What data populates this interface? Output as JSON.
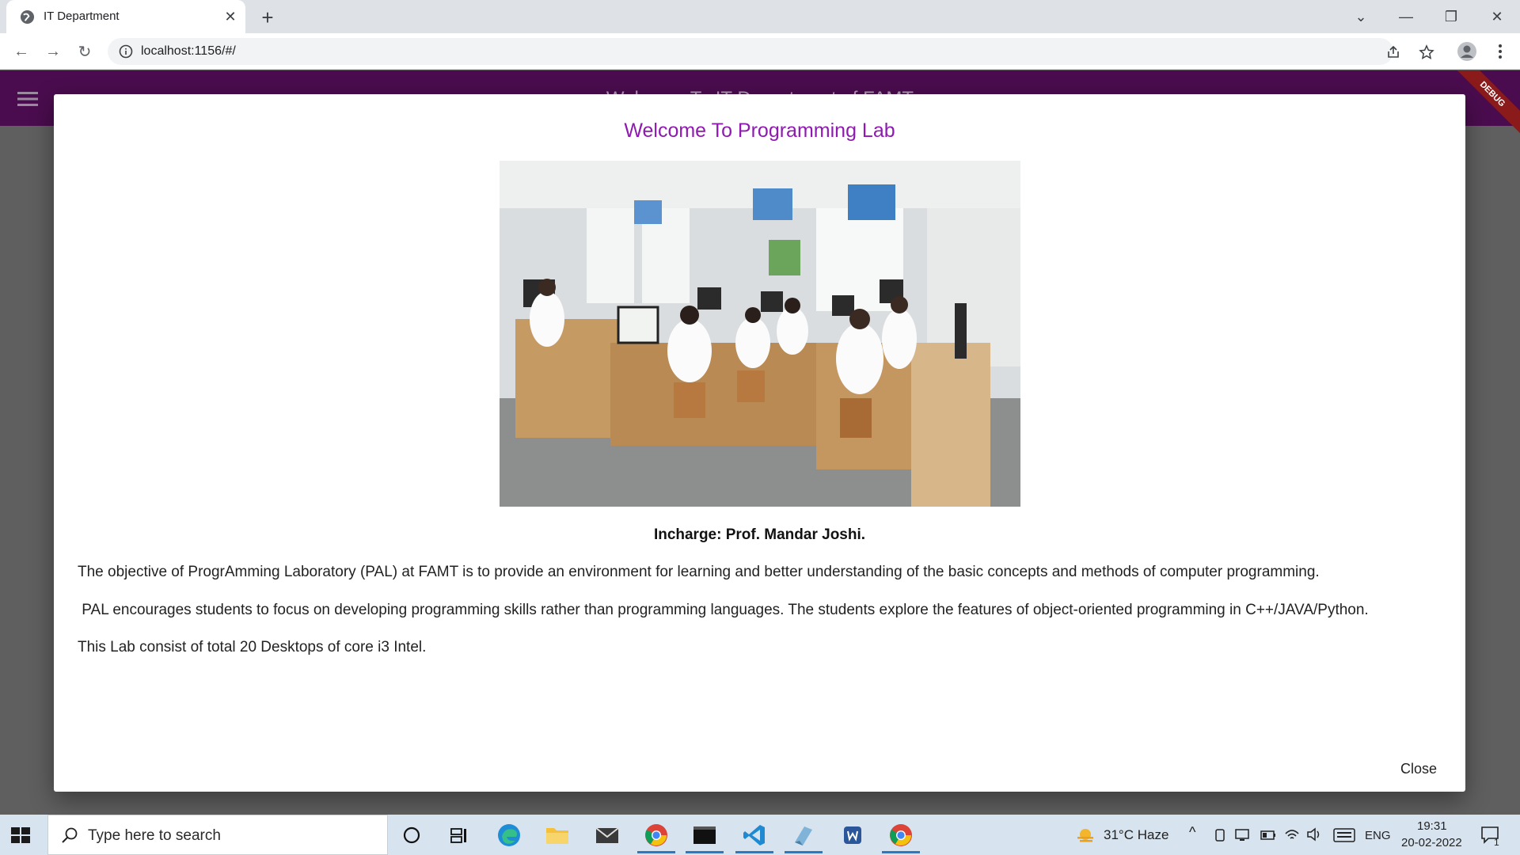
{
  "browser": {
    "tab_title": "IT Department",
    "url": "localhost:1156/#/"
  },
  "app": {
    "appbar_title": "Welcome To IT Department of FAMT",
    "debug_label": "DEBUG"
  },
  "dialog": {
    "title": "Welcome To Programming Lab",
    "photo_alt": "Programming Lab photo",
    "incharge": "Incharge: Prof. Mandar Joshi.",
    "paragraphs": [
      "The objective of ProgrAmming Laboratory (PAL) at FAMT is to provide an environment for learning and better understanding of the basic concepts and methods of computer programming.",
      " PAL encourages students to focus on developing programming skills rather than programming languages. The students explore the features of object-oriented programming in C++/JAVA/Python.",
      "This Lab consist of total 20 Desktops of core i3 Intel."
    ],
    "close_label": "Close"
  },
  "taskbar": {
    "search_placeholder": "Type here to search",
    "weather": "31°C  Haze",
    "language": "ENG",
    "time": "19:31",
    "date": "20-02-2022",
    "notification_count": "1"
  },
  "colors": {
    "appbar": "#4a0c4e",
    "dialog_title": "#8e1ab0",
    "taskbar": "#d7e3ee"
  }
}
